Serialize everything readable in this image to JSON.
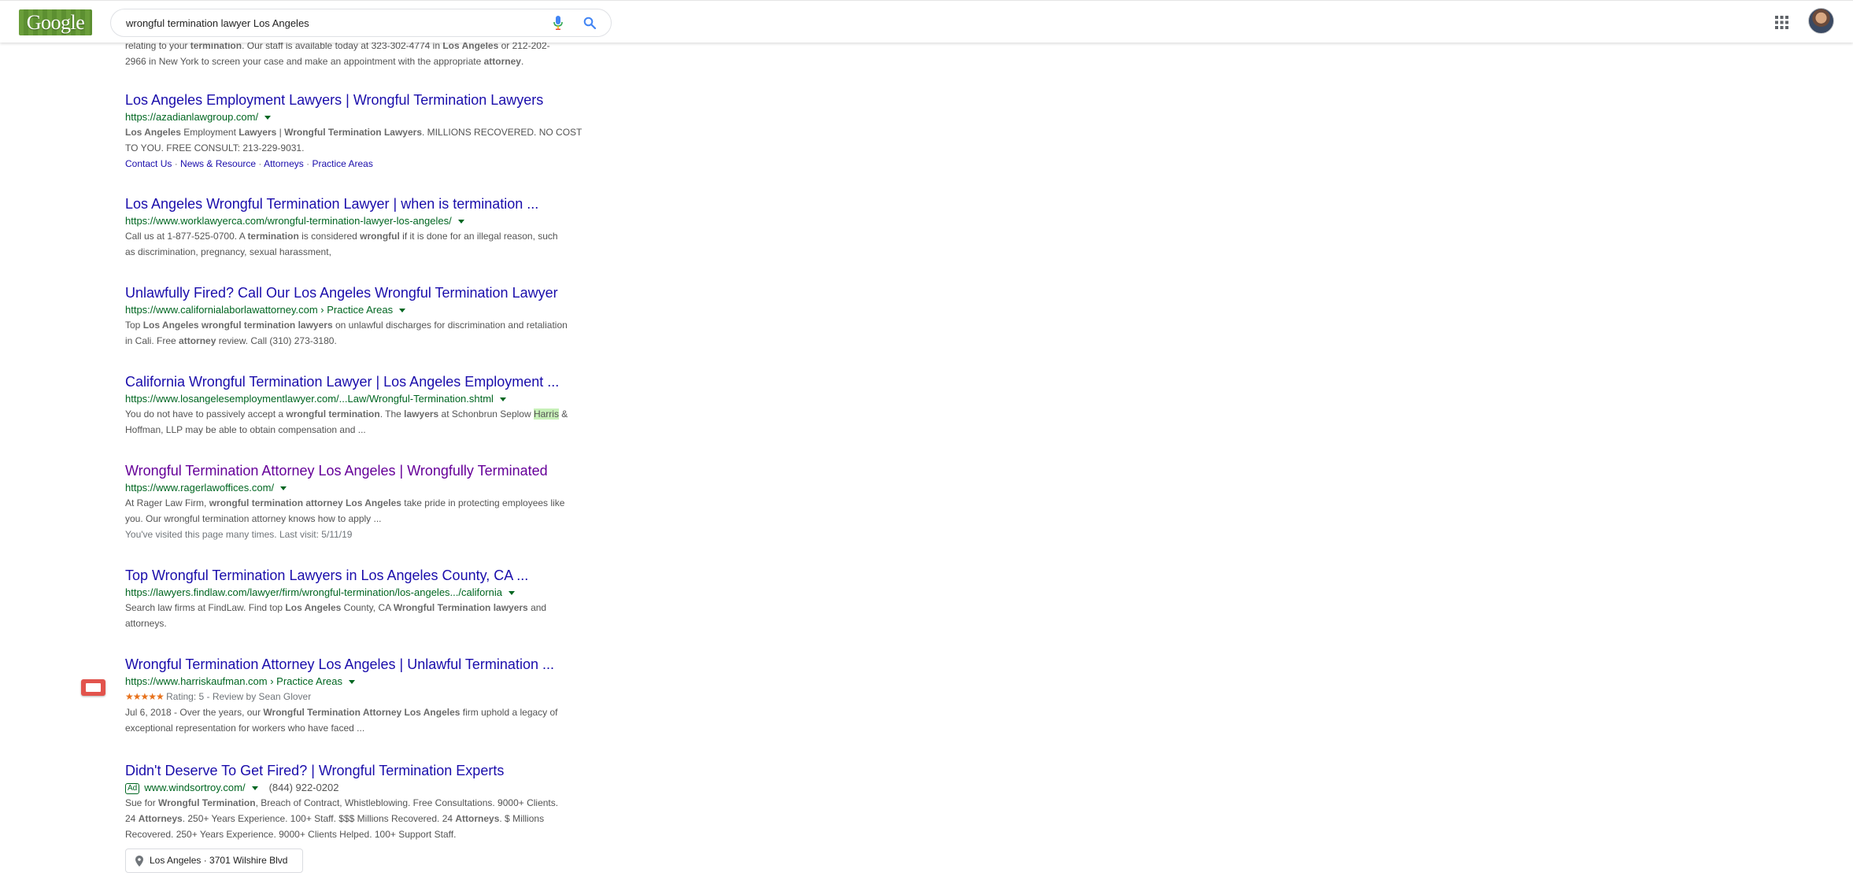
{
  "header": {
    "logo_text": "Google",
    "search_value": "wrongful termination lawyer Los Angeles",
    "icons": [
      "mic-icon",
      "search-icon",
      "apps-icon",
      "avatar"
    ]
  },
  "partial_snippet": {
    "line1_pre": "relating to your ",
    "line1_b1": "termination",
    "line1_mid": ". Our staff is available today at 323-302-4774 in ",
    "line1_b2": "Los Angeles",
    "line1_post": " or 212-202-",
    "line2_pre": "2966 in New York to screen your case and make an appointment with the appropriate ",
    "line2_b": "attorney",
    "line2_post": "."
  },
  "results": [
    {
      "title": "Los Angeles Employment Lawyers | Wrongful Termination Lawyers",
      "url": "https://azadianlawgroup.com/",
      "s1_b1": "Los Angeles",
      "s1_t1": " Employment ",
      "s1_b2": "Lawyers",
      "s1_t2": " | ",
      "s1_b3": "Wrongful Termination Lawyers",
      "s1_t3": ". MILLIONS RECOVERED. NO COST",
      "s2": "TO YOU. FREE CONSULT: 213-229-9031.",
      "sitelinks": [
        "Contact Us",
        "News & Resource",
        "Attorneys",
        "Practice Areas"
      ],
      "sitelink_sep": " · "
    },
    {
      "title": "Los Angeles Wrongful Termination Lawyer | when is termination ...",
      "url": "https://www.worklawyerca.com/wrongful-termination-lawyer-los-angeles/",
      "s1_t1": "Call us at 1-877-525-0700. A ",
      "s1_b1": "termination",
      "s1_t2": " is considered ",
      "s1_b2": "wrongful",
      "s1_t3": " if it is done for an illegal reason, such",
      "s2": "as discrimination, pregnancy, sexual harassment,"
    },
    {
      "title": "Unlawfully Fired? Call Our Los Angeles Wrongful Termination Lawyer",
      "url": "https://www.californialaborlawattorney.com › Practice Areas",
      "s1_t1": "Top ",
      "s1_b1": "Los Angeles wrongful termination lawyers",
      "s1_t2": " on unlawful discharges for discrimination and retaliation",
      "s2_t1": "in Cali. Free ",
      "s2_b1": "attorney",
      "s2_t2": " review. Call (310) 273-3180."
    },
    {
      "title": "California Wrongful Termination Lawyer | Los Angeles Employment ...",
      "url": "https://www.losangelesemploymentlawyer.com/...Law/Wrongful-Termination.shtml",
      "s1_t1": "You do not have to passively accept a ",
      "s1_b1": "wrongful termination",
      "s1_t2": ". The ",
      "s1_b2": "lawyers",
      "s1_t3": " at Schonbrun Seplow ",
      "s1_hl": "Harris",
      "s1_t4": " &",
      "s2": "Hoffman, LLP may be able to obtain compensation and ..."
    },
    {
      "title": "Wrongful Termination Attorney Los Angeles | Wrongfully Terminated",
      "url": "https://www.ragerlawoffices.com/",
      "s1_t1": "At Rager Law Firm, ",
      "s1_b1": "wrongful termination attorney Los Angeles",
      "s1_t2": " take pride in protecting employees like",
      "s2": "you. Our wrongful termination attorney knows how to apply ...",
      "visited_note": "You've visited this page many times. Last visit: 5/11/19"
    },
    {
      "title": "Top Wrongful Termination Lawyers in Los Angeles County, CA ...",
      "url": "https://lawyers.findlaw.com/lawyer/firm/wrongful-termination/los-angeles.../california",
      "s1_t1": "Search law firms at FindLaw. Find top ",
      "s1_b1": "Los Angeles",
      "s1_t2": " County, CA ",
      "s1_b2": "Wrongful Termination lawyers",
      "s1_t3": " and",
      "s2": "attorneys."
    },
    {
      "title": "Wrongful Termination Attorney Los Angeles | Unlawful Termination ...",
      "url": "https://www.harriskaufman.com › Practice Areas",
      "stars": "★★★★★",
      "rating": "Rating: 5 - Review by Sean Glover",
      "rating_value": 5,
      "s1_t1": "Jul 6, 2018 - Over the years, our ",
      "s1_b1": "Wrongful Termination Attorney Los Angeles",
      "s1_t2": " firm uphold a legacy of",
      "s2": "exceptional representation for workers who have faced ..."
    },
    {
      "title": "Didn't Deserve To Get Fired? | Wrongful Termination Experts",
      "ad_label": "Ad",
      "url": "www.windsortroy.com/",
      "phone": "(844) 922-0202",
      "s1_t1": "Sue for ",
      "s1_b1": "Wrongful Termination",
      "s1_t2": ", Breach of Contract, Whistleblowing. Free Consultations. 9000+ Clients.",
      "s2_t1": "24 ",
      "s2_b1": "Attorneys",
      "s2_t2": ". 250+ Years Experience. 100+ Staff. $$$ Millions Recovered. 24 ",
      "s2_b2": "Attorneys",
      "s2_t3": ". $ Millions",
      "s3": "Recovered. 250+ Years Experience. 9000+ Clients Helped. 100+ Support Staff.",
      "location": "Los Angeles · 3701 Wilshire Blvd"
    }
  ],
  "colors": {
    "link": "#1a0dab",
    "visited": "#660099",
    "url_green": "#006621",
    "snippet": "#545454",
    "star_orange": "#e7711b"
  }
}
